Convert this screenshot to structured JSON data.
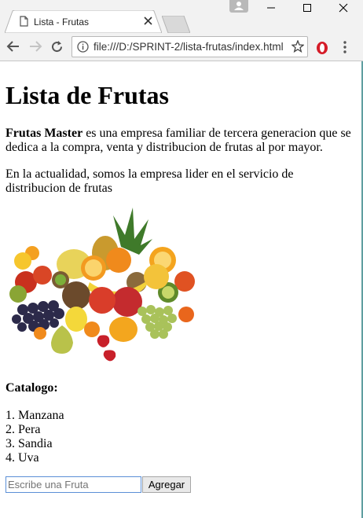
{
  "tab": {
    "title": "Lista - Frutas"
  },
  "address": {
    "url": "file:///D:/SPRINT-2/lista-frutas/index.html"
  },
  "page": {
    "heading": "Lista de Frutas",
    "intro_bold": "Frutas Master",
    "intro_rest": " es una empresa familiar de tercera generacion que se dedica a la compra, venta y distribucion de frutas al por mayor.",
    "para2": "En la actualidad, somos la empresa lider en el servicio de distribucion de frutas",
    "catalog_label": "Catalogo:",
    "items": [
      "1. Manzana",
      "2. Pera",
      "3. Sandia",
      "4. Uva"
    ]
  },
  "form": {
    "placeholder": "Escribe una Fruta",
    "button_label": "Agregar"
  },
  "colors": {
    "chrome_bg": "#f2f2f2",
    "input_border": "#5b8fd6",
    "opera_red": "#d51c28"
  }
}
